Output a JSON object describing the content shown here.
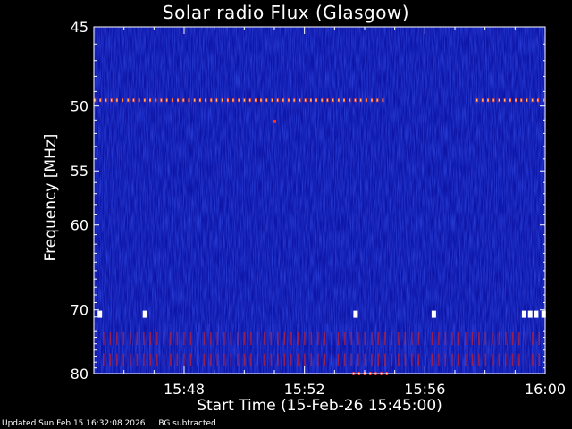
{
  "chart_data": {
    "type": "heatmap",
    "title": "Solar radio Flux (Glasgow)",
    "xlabel": "Start Time (15-Feb-26 15:45:00)",
    "ylabel": "Frequency [MHz]",
    "x_ticks": [
      "15:48",
      "15:52",
      "15:56",
      "16:00"
    ],
    "x_tick_minutes": [
      48,
      52,
      56,
      60
    ],
    "xlim_minutes": [
      45,
      60
    ],
    "y_ticks": [
      45,
      50,
      55,
      60,
      70,
      80
    ],
    "ylim": [
      45,
      80
    ],
    "y_scale": "reciprocal",
    "colormap": [
      "#000080",
      "#1a2ae0",
      "#ff2a00",
      "#ffffff"
    ],
    "features": [
      {
        "kind": "dotted_band",
        "freq_mhz": 49.6,
        "t_start": 45.0,
        "t_end": 54.6,
        "color": "#ff5020"
      },
      {
        "kind": "dotted_band",
        "freq_mhz": 49.6,
        "t_start": 57.7,
        "t_end": 60.0,
        "color": "#ff5020"
      },
      {
        "kind": "spot",
        "freq_mhz": 51.1,
        "t": 51.0,
        "color": "#ff3010"
      },
      {
        "kind": "white_marks",
        "freq_mhz": 70.6,
        "t_list": [
          45.2,
          46.7,
          53.7,
          56.3,
          59.3,
          59.5,
          59.7,
          59.95
        ],
        "color": "#ffffff"
      },
      {
        "kind": "red_band",
        "freq_mhz": 74.2,
        "t_start": 45.3,
        "t_end": 60.0,
        "color": "#c02030"
      },
      {
        "kind": "red_band",
        "freq_mhz": 77.6,
        "t_start": 45.3,
        "t_end": 60.0,
        "color": "#c02030"
      },
      {
        "kind": "dotted_band",
        "freq_mhz": 80.0,
        "t_start": 53.6,
        "t_end": 54.8,
        "color": "#ff3030"
      }
    ]
  },
  "footer": {
    "updated": "Updated Sun Feb 15 16:32:08 2026",
    "note": "BG subtracted"
  }
}
